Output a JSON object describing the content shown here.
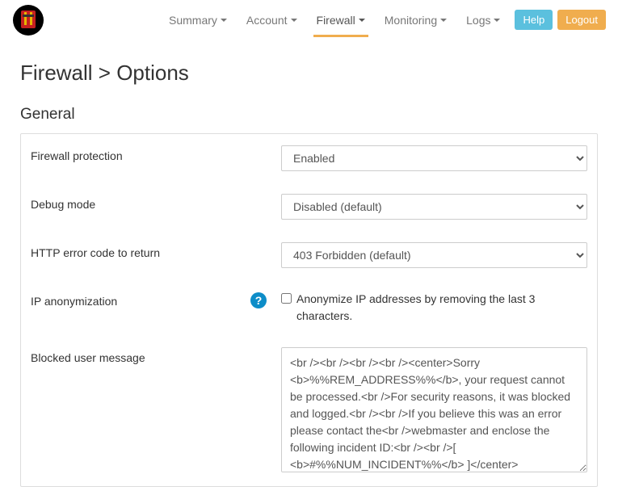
{
  "nav": {
    "items": [
      {
        "label": "Summary",
        "active": false
      },
      {
        "label": "Account",
        "active": false
      },
      {
        "label": "Firewall",
        "active": true
      },
      {
        "label": "Monitoring",
        "active": false
      },
      {
        "label": "Logs",
        "active": false
      }
    ],
    "help": "Help",
    "logout": "Logout"
  },
  "page": {
    "title": "Firewall > Options"
  },
  "section": {
    "general": "General"
  },
  "fields": {
    "firewall_protection": {
      "label": "Firewall protection",
      "value": "Enabled"
    },
    "debug_mode": {
      "label": "Debug mode",
      "value": "Disabled (default)"
    },
    "http_error": {
      "label": "HTTP error code to return",
      "value": "403 Forbidden (default)"
    },
    "ip_anon": {
      "label": "IP anonymization",
      "checkbox_label": "Anonymize IP addresses by removing the last 3 characters.",
      "checked": false
    },
    "blocked_msg": {
      "label": "Blocked user message",
      "value": "<br /><br /><br /><br /><center>Sorry <b>%%REM_ADDRESS%%</b>, your request cannot be processed.<br />For security reasons, it was blocked and logged.<br /><br />If you believe this was an error please contact the<br />webmaster and enclose the following incident ID:<br /><br />[ <b>#%%NUM_INCIDENT%%</b> ]</center>"
    }
  },
  "icons": {
    "help_tooltip": "?"
  }
}
